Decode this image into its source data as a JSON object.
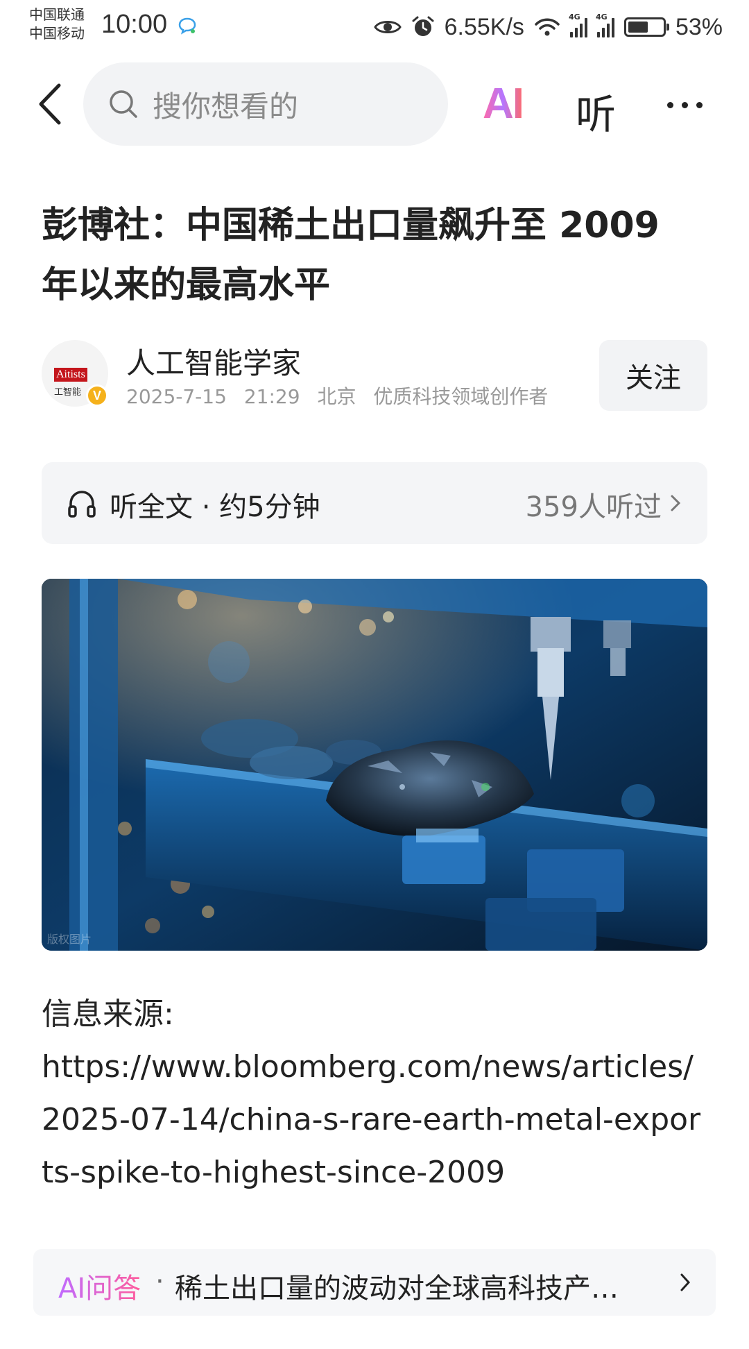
{
  "status_bar": {
    "carrier_1": "中国联通",
    "carrier_2": "中国移动",
    "time": "10:00",
    "net_speed": "6.55K/s",
    "battery_percent": "53%",
    "battery_level": 0.53,
    "icons": [
      "message-bubble-icon",
      "eye-icon",
      "alarm-icon",
      "wifi-icon",
      "signal-4g-icon",
      "signal-4g-icon",
      "battery-icon"
    ]
  },
  "nav": {
    "search_placeholder": "搜你想看的",
    "ai_label": "AI",
    "listen_label": "听",
    "icons": [
      "back-arrow-icon",
      "search-icon",
      "more-dots-icon"
    ]
  },
  "article": {
    "title": "彭博社：中国稀土出口量飙升至 2009 年以来的最高水平",
    "author": {
      "name": "人工智能学家",
      "date": "2025-7-15",
      "time": "21:29",
      "location": "北京",
      "tag": "优质科技领域创作者",
      "avatar_text": "Aitists",
      "avatar_subtext": "工智能",
      "verified_mark": "V"
    },
    "follow_label": "关注",
    "listen_bar": {
      "label": "听全文 · 约5分钟",
      "count": "359人听过"
    },
    "image": {
      "watermark": "版权图片"
    },
    "body": {
      "source_label": "信息来源:",
      "source_url": "https://www.bloomberg.com/news/articles/2025-07-14/china-s-rare-earth-metal-exports-spike-to-highest-since-2009"
    }
  },
  "ai_qa": {
    "label": "AI问答",
    "separator": "·",
    "question": "稀土出口量的波动对全球高科技产…"
  },
  "colors": {
    "accent_ai_start": "#ff6aa7",
    "accent_ai_end": "#b476ff",
    "verified": "#f5b11b",
    "search_bg": "#f2f3f5"
  }
}
